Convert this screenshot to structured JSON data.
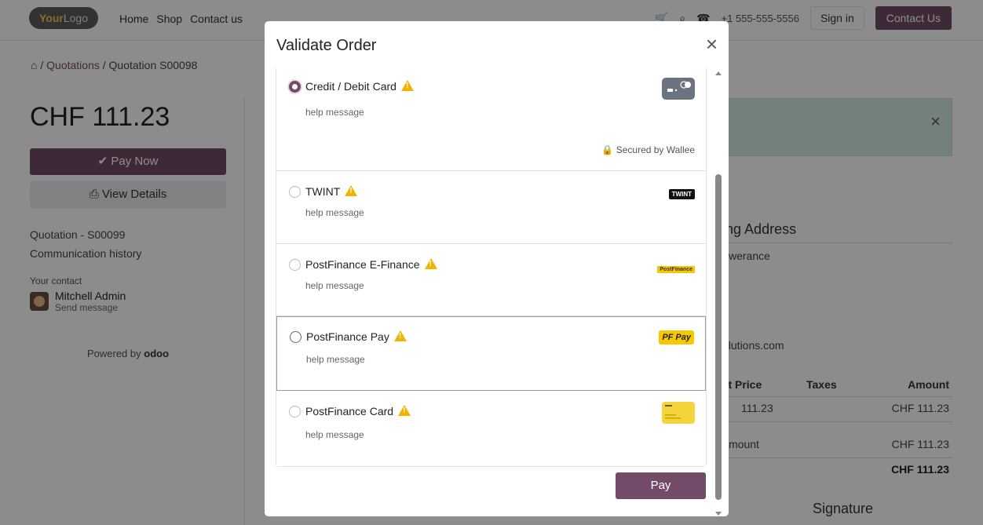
{
  "nav": {
    "logo_your": "Your",
    "logo_logo": "Logo",
    "links": [
      "Home",
      "Shop",
      "Contact us"
    ],
    "phone": "+1 555-555-5556",
    "signin": "Sign in",
    "contact_btn": "Contact Us"
  },
  "breadcrumb": {
    "home_icon": "home-icon",
    "sep": "/",
    "quotations": "Quotations",
    "current": "Quotation S00098"
  },
  "sidebar": {
    "price": "CHF 111.23",
    "pay_now": "✔ Pay Now",
    "view_details": "⎙ View Details",
    "quotation_link": "Quotation - S00099",
    "history_link": "Communication history",
    "contact_label": "Your contact",
    "contact_name": "Mitchell Admin",
    "send_message": "Send message",
    "powered_by": "Powered by",
    "odoo": "odoo"
  },
  "background": {
    "shipping_title": "pping Address",
    "shipping_line": "werance",
    "email_line": "olutions.com",
    "table_head": {
      "unit_price": "nit Price",
      "taxes": "Taxes",
      "amount": "Amount"
    },
    "row1": {
      "unit_price": "111.23",
      "amount": "CHF 111.23"
    },
    "row2": {
      "label": "mount",
      "amount": "CHF 111.23"
    },
    "row3": {
      "amount": "CHF 111.23"
    },
    "signature": "Signature"
  },
  "modal": {
    "title": "Validate Order",
    "close": "×",
    "pay_button": "Pay",
    "secured_by": "Secured by Wallee",
    "methods": [
      {
        "name": "Credit / Debit Card",
        "help": "help message",
        "logo": "card-icon",
        "selected": true
      },
      {
        "name": "TWINT",
        "help": "help message",
        "logo": "twint-logo",
        "logo_text": "TWINT",
        "selected": false
      },
      {
        "name": "PostFinance E-Finance",
        "help": "help message",
        "logo": "postfinance-logo",
        "logo_text": "PostFinance",
        "selected": false
      },
      {
        "name": "PostFinance Pay",
        "help": "help message",
        "logo": "pfpay-logo",
        "logo_text": "PF Pay",
        "selected": false
      },
      {
        "name": "PostFinance Card",
        "help": "help message",
        "logo": "postfinance-card-icon",
        "selected": false
      }
    ]
  },
  "colors": {
    "brand": "#714b67",
    "warning": "#f0b400",
    "alert_bg": "#d4ebe1"
  }
}
